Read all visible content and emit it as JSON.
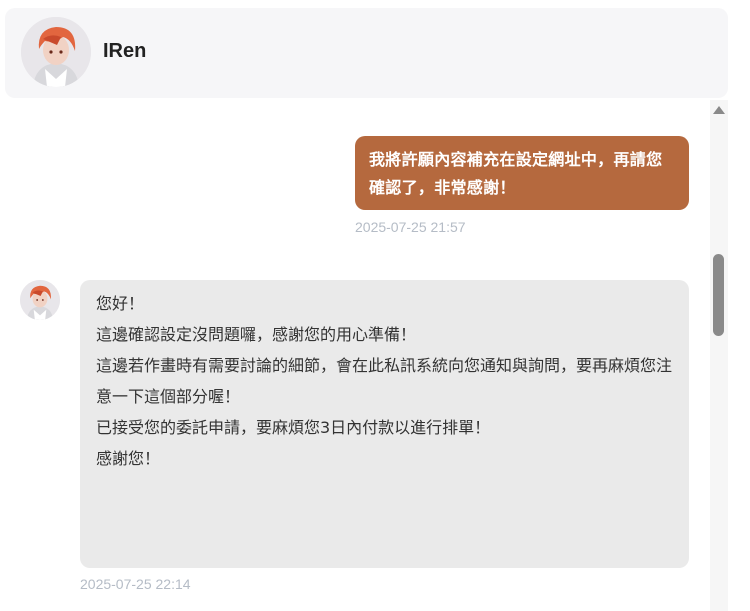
{
  "header": {
    "avatar_icon": "artist-avatar-icon",
    "name": "IRen"
  },
  "messages": {
    "outgoing": {
      "text": "我將許願內容補充在設定網址中，再請您確認了，非常感謝！",
      "timestamp": "2025-07-25 21:57",
      "bubble_color": "#b5693e"
    },
    "incoming": {
      "avatar_icon": "artist-avatar-icon",
      "lines": [
        "您好！",
        "",
        "這邊確認設定沒問題囉，感謝您的用心準備！",
        "這邊若作畫時有需要討論的細節，會在此私訊系統向您通知與詢問，要再麻煩您注意一下這個部分喔！",
        "",
        "已接受您的委託申請，要麻煩您3日內付款以進行排單！",
        "",
        "感謝您！"
      ],
      "timestamp": "2025-07-25 22:14",
      "bubble_color": "#eaeaea"
    }
  },
  "scrollbar": {
    "up_icon": "scroll-up-arrow-icon"
  }
}
